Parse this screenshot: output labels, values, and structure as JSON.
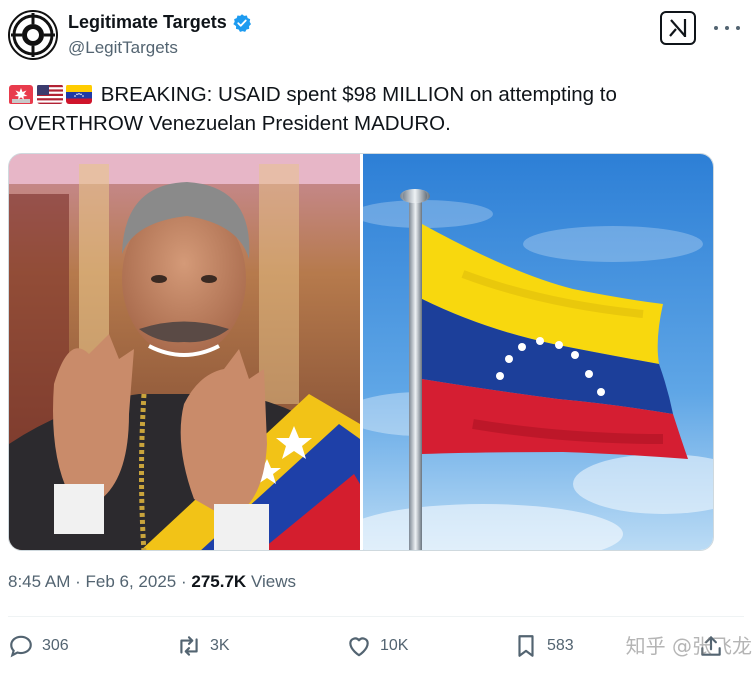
{
  "header": {
    "display_name": "Legitimate Targets",
    "handle": "@LegitTargets",
    "verified_color": "#1d9bf0"
  },
  "tweet": {
    "emojis": [
      "rotating-light-icon",
      "us-flag-icon",
      "venezuela-flag-icon"
    ],
    "text": "BREAKING: USAID spent $98 MILLION on attempting to OVERTHROW Venezuelan President MADURO."
  },
  "media": {
    "images": [
      "maduro-photo",
      "venezuela-flag-photo"
    ]
  },
  "meta": {
    "time": "8:45 AM",
    "date": "Feb 6, 2025",
    "views_count": "275.7K",
    "views_label": "Views"
  },
  "actions": {
    "replies": "306",
    "reposts": "3K",
    "likes": "10K",
    "bookmarks": "583"
  },
  "watermark": "知乎 @张飞龙"
}
